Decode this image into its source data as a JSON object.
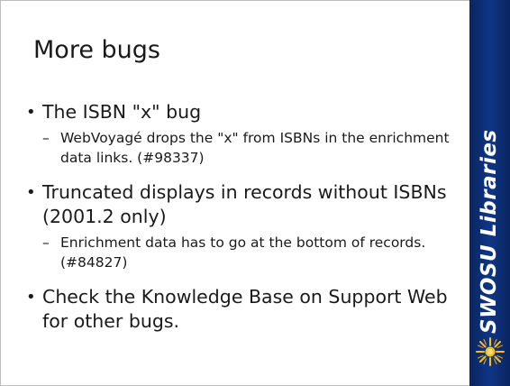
{
  "slide": {
    "title": "More bugs",
    "bullets": [
      {
        "text": "The ISBN \"x\" bug",
        "sub": "WebVoyagé drops the \"x\" from ISBNs in the enrichment data links. (#98337)"
      },
      {
        "text": "Truncated displays in records without ISBNs (2001.2 only)",
        "sub": "Enrichment data has to go at the bottom of records. (#84827)"
      },
      {
        "text": "Check the Knowledge Base on Support Web for other bugs."
      }
    ]
  },
  "sidebar": {
    "brand_text": "SWOSU Libraries",
    "brand_color": "#0b2a6a",
    "logo_icon": "sun-burst-icon",
    "logo_color": "#f2c21a"
  }
}
